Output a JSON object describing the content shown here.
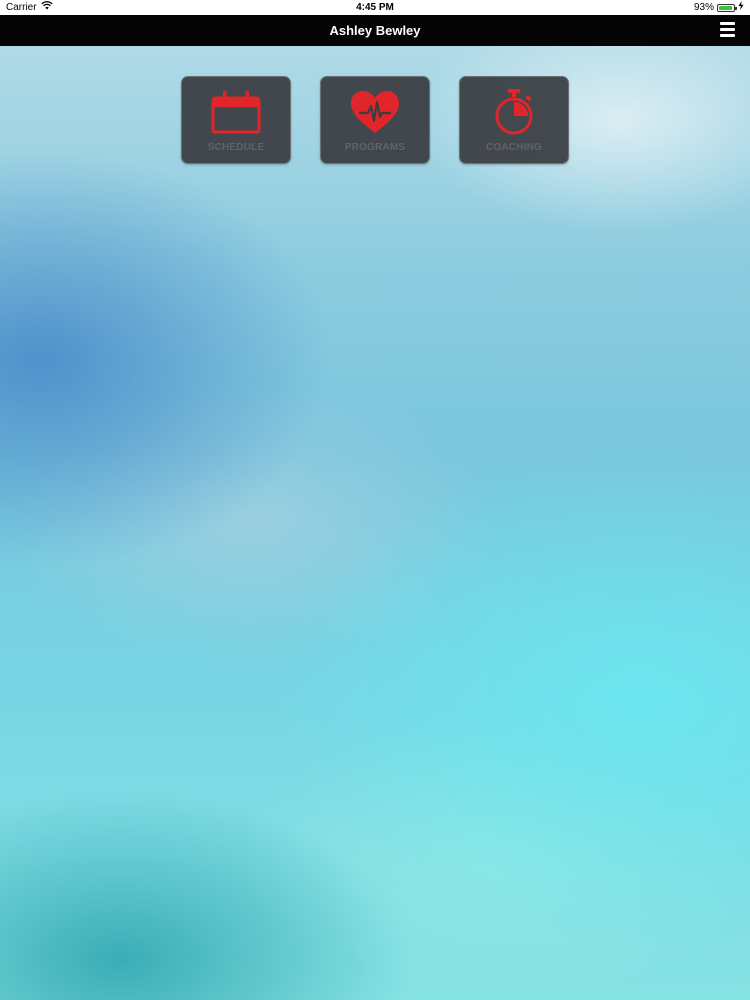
{
  "status_bar": {
    "carrier": "Carrier",
    "time": "4:45 PM",
    "battery_percent": "93%",
    "battery_level": 0.93,
    "icons": [
      "wifi-icon",
      "battery-icon",
      "charging-icon"
    ]
  },
  "nav": {
    "title": "Ashley Bewley",
    "menu_icon": "hamburger-menu-icon"
  },
  "tiles": [
    {
      "label": "SCHEDULE",
      "icon": "calendar-icon"
    },
    {
      "label": "PROGRAMS",
      "icon": "heart-pulse-icon"
    },
    {
      "label": "COACHING",
      "icon": "stopwatch-icon"
    }
  ],
  "colors": {
    "icon_red": "#e0262a",
    "tile_bg": "#3a3e42",
    "nav_bg": "#050505"
  }
}
